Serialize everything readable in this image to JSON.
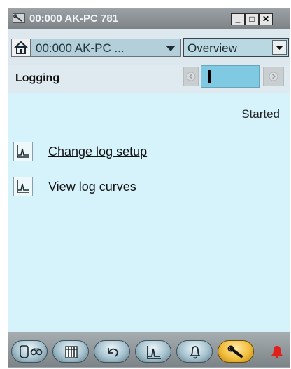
{
  "window": {
    "title": "00:000 AK-PC 781",
    "icon": "wrench-icon",
    "controls": {
      "minimize": "_",
      "maximize": "□",
      "close": "✕"
    }
  },
  "toolbar": {
    "home_icon": "home-icon",
    "device_selector": {
      "value": "00:000 AK-PC ..."
    },
    "view_selector": {
      "value": "Overview"
    }
  },
  "section": {
    "title": "Logging",
    "pager": {
      "value": ""
    }
  },
  "content": {
    "status": "Started",
    "links": [
      {
        "label": "Change log setup",
        "icon": "log-chart-icon"
      },
      {
        "label": "View log curves",
        "icon": "log-chart-icon"
      }
    ]
  },
  "bottom_nav": {
    "buttons": [
      {
        "icon": "status-overview-icon",
        "active": false
      },
      {
        "icon": "configuration-grid-icon",
        "active": false
      },
      {
        "icon": "manual-control-icon",
        "active": false
      },
      {
        "icon": "log-chart-icon",
        "active": false
      },
      {
        "icon": "alarm-bell-icon",
        "active": false
      },
      {
        "icon": "service-wrench-icon",
        "active": true
      }
    ],
    "alarm_indicator": {
      "icon": "alarm-bell-red-icon",
      "color": "#e0201b"
    }
  },
  "colors": {
    "title_bar": "#8d9397",
    "content_bg": "#d6f3fb",
    "pager_input": "#7fc9e3",
    "active_nav": "#f2bf3e",
    "alarm": "#e0201b"
  }
}
